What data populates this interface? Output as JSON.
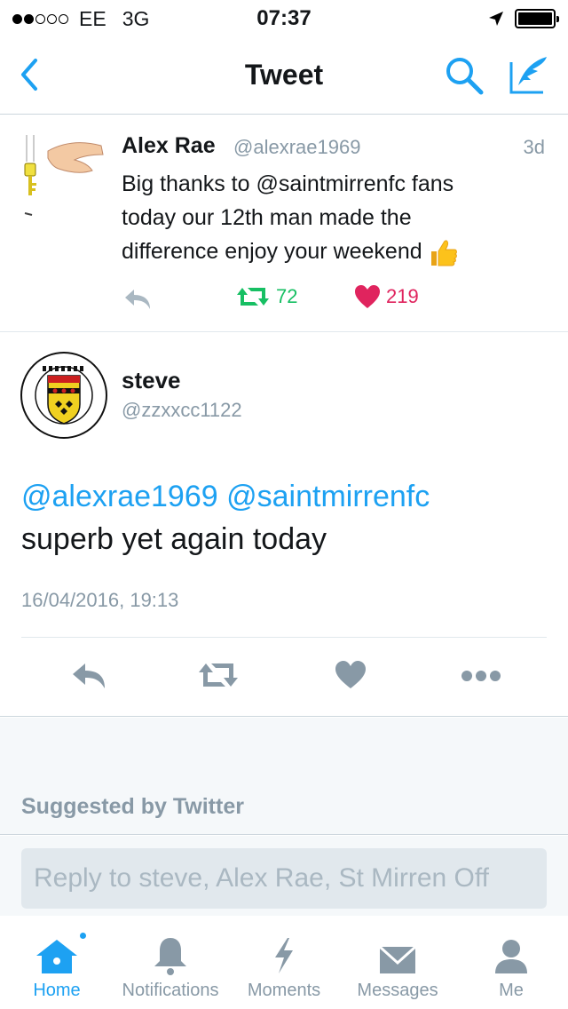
{
  "status_bar": {
    "carrier": "EE",
    "network": "3G",
    "time": "07:37",
    "signal_bars_filled": 2,
    "signal_bars_total": 5
  },
  "nav": {
    "title": "Tweet",
    "back_icon": "chevron-left-icon",
    "search_icon": "search-icon",
    "compose_icon": "quill-compose-icon"
  },
  "quoted_tweet": {
    "name": "Alex Rae",
    "handle": "@alexrae1969",
    "time": "3d",
    "text_lines": [
      "Big thanks to @saintmirrenfc  fans",
      "today our 12th man made the",
      "difference enjoy your weekend"
    ],
    "emoji": "thumbs-up",
    "retweet_count": "72",
    "like_count": "219"
  },
  "main_tweet": {
    "name": "steve",
    "handle": "@zzxxcc1122",
    "mention1": "@alexrae1969",
    "mention2": "@saintmirrenfc",
    "text": "superb yet again today",
    "date": "16/04/2016, 19:13"
  },
  "suggested": {
    "label": "Suggested by Twitter"
  },
  "reply": {
    "placeholder": "Reply to steve, Alex Rae, St Mirren Off"
  },
  "tabs": [
    {
      "label": "Home",
      "icon": "home-icon",
      "active": true
    },
    {
      "label": "Notifications",
      "icon": "bell-icon",
      "active": false
    },
    {
      "label": "Moments",
      "icon": "lightning-icon",
      "active": false
    },
    {
      "label": "Messages",
      "icon": "envelope-icon",
      "active": false
    },
    {
      "label": "Me",
      "icon": "person-icon",
      "active": false
    }
  ],
  "colors": {
    "accent": "#1da1f2",
    "retweet": "#17bf63",
    "like": "#e0245e",
    "muted": "#8899a6"
  }
}
